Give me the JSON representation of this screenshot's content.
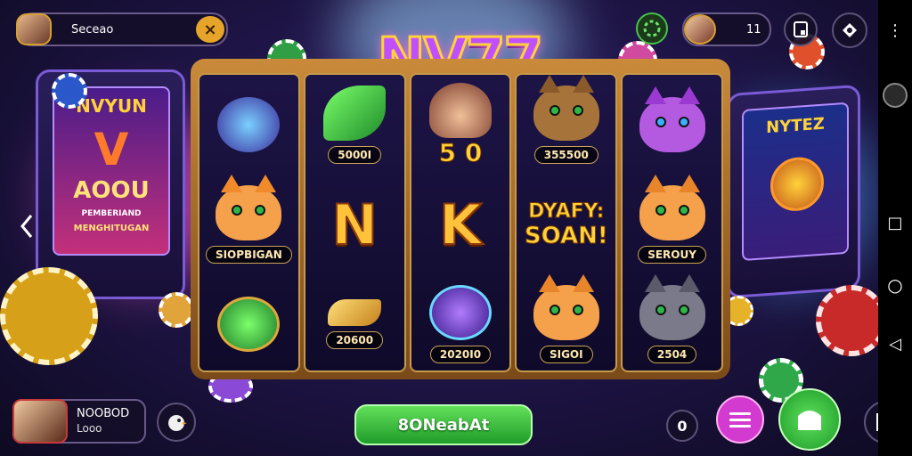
{
  "logo": {
    "text": "NV77"
  },
  "top_bar": {
    "player_name": "Seceao",
    "close_symbol": "×",
    "count_value": "11",
    "icons": [
      "avatar-icon",
      "close-icon",
      "badge-icon",
      "deposit-icon",
      "support-icon"
    ]
  },
  "left_machine": {
    "title": "NVYUN",
    "big_text": "AOOU",
    "line1": "PEMBERIAND",
    "line2": "MENGHITUGAN"
  },
  "right_machine": {
    "title": "NYTEZ"
  },
  "reels": [
    {
      "cells": [
        {
          "type": "gem-bowl",
          "value": ""
        },
        {
          "type": "cat",
          "value": "SIOPBIGAN"
        },
        {
          "type": "green-bowl",
          "value": ""
        }
      ]
    },
    {
      "cells": [
        {
          "type": "leaf",
          "value": "5000I"
        },
        {
          "type": "letter",
          "value": "N"
        },
        {
          "type": "key",
          "value": "20600"
        }
      ]
    },
    {
      "cells": [
        {
          "type": "hat-girl",
          "value": "5 0"
        },
        {
          "type": "letter",
          "value": "K"
        },
        {
          "type": "gem",
          "value": "2020I0"
        }
      ]
    },
    {
      "cells": [
        {
          "type": "cat-boss",
          "value": "355500"
        },
        {
          "type": "banner",
          "value": "DYAFY: SOAN!"
        },
        {
          "type": "cat",
          "value": "SIGOI"
        }
      ]
    },
    {
      "cells": [
        {
          "type": "cat",
          "value": ""
        },
        {
          "type": "cat",
          "value": "SEROUY"
        },
        {
          "type": "cat",
          "value": "2504"
        }
      ]
    }
  ],
  "reel_labels": {
    "nk_left": "N",
    "nk_right": "K",
    "banner_line1": "DYAFY:",
    "banner_line2": "SOAN!"
  },
  "bottom_bar": {
    "player_name": "NOOBOD",
    "player_sub": "Looo",
    "spin_label": "8ONeabAt",
    "info_badge": "0"
  },
  "navbar": {
    "back": "◁",
    "home": "○",
    "recent": "□",
    "menu": "⋮"
  },
  "colors": {
    "background": "#1f1548",
    "frame_gold": "#c98a3a",
    "spin_green": "#2fb33a",
    "logo_purple": "#c04fff",
    "menu_pink": "#d23ad0"
  }
}
